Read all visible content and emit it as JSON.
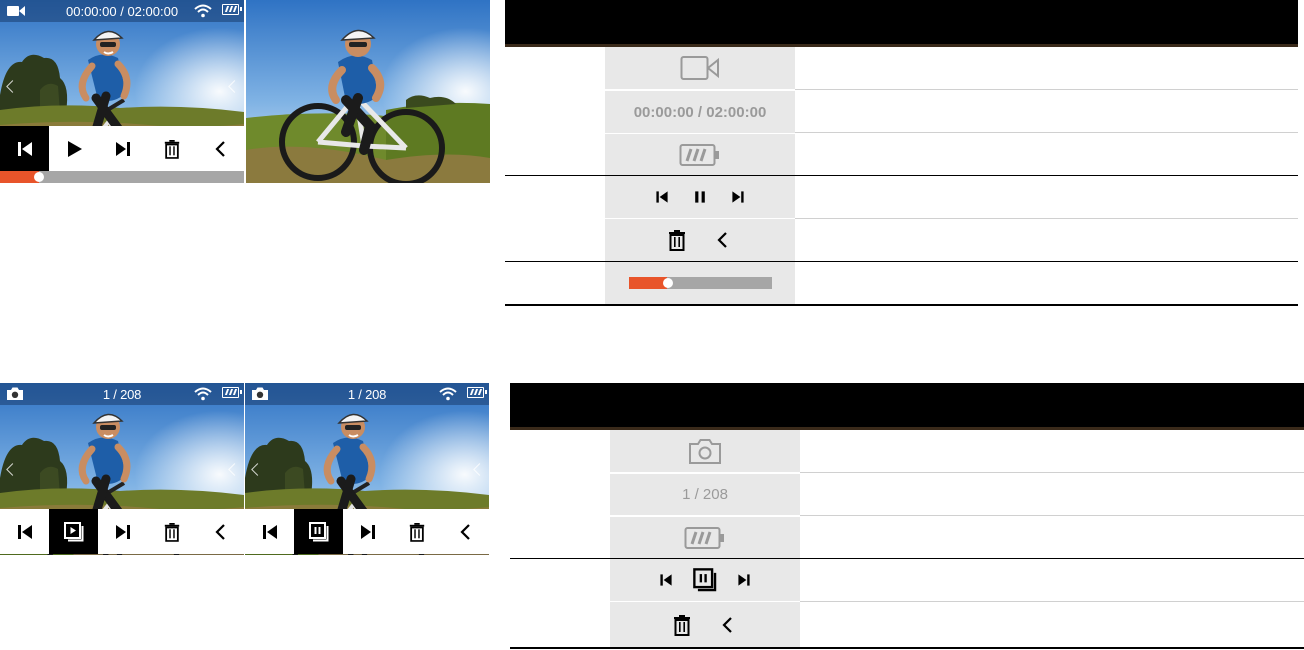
{
  "video_mode": {
    "timecode": "00:00:00 / 02:00:00",
    "progress_fraction": 0.16,
    "table": {
      "timecode_text": "00:00:00 / 02:00:00"
    }
  },
  "photo_mode": {
    "counter": "1 / 208",
    "table": {
      "counter_text": "1 / 208"
    }
  },
  "icons": [
    "video-camera-icon",
    "wifi-icon",
    "battery-icon",
    "photo-camera-icon",
    "skip-previous-icon",
    "play-icon",
    "pause-icon",
    "skip-next-icon",
    "delete-icon",
    "back-icon",
    "slideshow-play-icon",
    "slideshow-pause-icon"
  ],
  "colors": {
    "accent": "#e8542a",
    "track": "#a6a6a6",
    "table_header": "#000000",
    "icon_cell": "#e8e8e8"
  }
}
